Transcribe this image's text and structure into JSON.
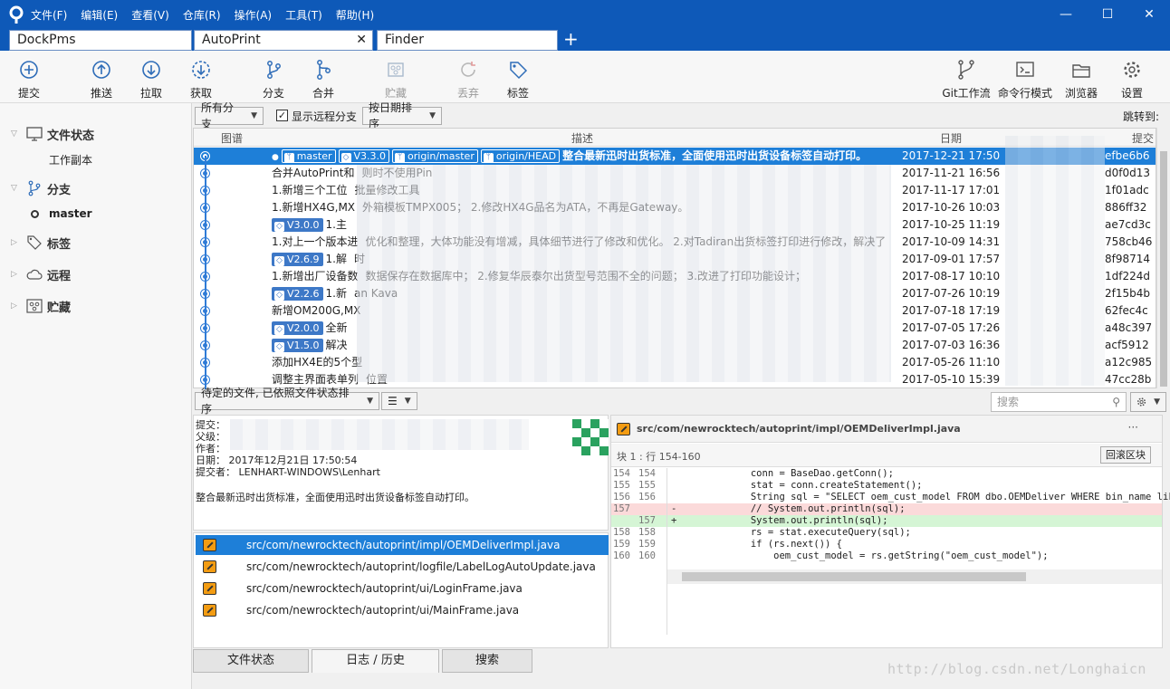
{
  "colors": {
    "titlebar": "#0e59b8",
    "selection": "#1e7fd8",
    "tag": "#3d78c7"
  },
  "menu": [
    "文件(F)",
    "编辑(E)",
    "查看(V)",
    "仓库(R)",
    "操作(A)",
    "工具(T)",
    "帮助(H)"
  ],
  "tabs": {
    "tab1": "DockPms",
    "tab2": "AutoPrint",
    "tab2_close": "✕",
    "tab3": "Finder",
    "add": "+"
  },
  "window_controls": {
    "min": "—",
    "max": "☐",
    "close": "✕"
  },
  "toolbar": {
    "commit": "提交",
    "push": "推送",
    "pull": "拉取",
    "fetch": "获取",
    "branch": "分支",
    "merge": "合并",
    "stash": "贮藏",
    "discard": "丢弃",
    "tag": "标签",
    "git_flow": "Git工作流",
    "terminal": "命令行模式",
    "explorer": "浏览器",
    "settings": "设置"
  },
  "sidebar": {
    "file_status": "文件状态",
    "working_copy": "工作副本",
    "branches": "分支",
    "master": "master",
    "tags": "标签",
    "remotes": "远程",
    "stashes": "贮藏"
  },
  "filters": {
    "all_branches": "所有分支",
    "show_remote": "显示远程分支",
    "sort": "按日期排序",
    "jump_to": "跳转到:"
  },
  "table_headers": {
    "graph": "图谱",
    "desc": "描述",
    "date": "日期",
    "commit": "提交"
  },
  "commits": [
    {
      "refs": [
        "master",
        "V3.3.0",
        "origin/master",
        "origin/HEAD"
      ],
      "ref_types": [
        "branch",
        "tag",
        "branch",
        "branch"
      ],
      "desc": "整合最新迅时出货标准，全面使用迅时出货设备标签自动打印。",
      "date": "2017-12-21 17:50",
      "hash": "efbe6b6"
    },
    {
      "refs": [],
      "desc": "合并AutoPrint和",
      "desc_tail": "则时不使用Pin",
      "date": "2017-11-21 16:56",
      "hash": "d0f0d13"
    },
    {
      "refs": [],
      "desc": "1.新增三个工位",
      "desc_tail": "批量修改工具",
      "date": "2017-11-17 17:01",
      "hash": "1f01adc"
    },
    {
      "refs": [],
      "desc": "1.新增HX4G,MX",
      "desc_tail": "外箱模板TMPX005； 2.修改HX4G品名为ATA，不再是Gateway。",
      "date": "2017-10-26 10:03",
      "hash": "886ff32"
    },
    {
      "refs": [
        "V3.0.0"
      ],
      "ref_types": [
        "tag"
      ],
      "desc": "1.主",
      "desc_tail": "",
      "date": "2017-10-25 11:19",
      "hash": "ae7cd3c"
    },
    {
      "refs": [],
      "desc": "1.对上一个版本进",
      "desc_tail": "优化和整理，大体功能没有增减，具体细节进行了修改和优化。 2.对Tadiran出货标签打印进行修改，解决了",
      "date": "2017-10-09 14:31",
      "hash": "758cb46"
    },
    {
      "refs": [
        "V2.6.9"
      ],
      "ref_types": [
        "tag"
      ],
      "desc": "1.解",
      "desc_tail": "时",
      "date": "2017-09-01 17:57",
      "hash": "8f98714"
    },
    {
      "refs": [],
      "desc": "1.新增出厂设备数",
      "desc_tail": "数据保存在数据库中； 2.修复华辰泰尔出货型号范围不全的问题； 3.改进了打印功能设计；",
      "date": "2017-08-17 10:10",
      "hash": "1df224d"
    },
    {
      "refs": [
        "V2.2.6"
      ],
      "ref_types": [
        "tag"
      ],
      "desc": "1.新",
      "desc_tail": "an Kava",
      "date": "2017-07-26 10:19",
      "hash": "2f15b4b"
    },
    {
      "refs": [],
      "desc": "新增OM200G,MX",
      "desc_tail": "",
      "date": "2017-07-18 17:19",
      "hash": "62fec4c"
    },
    {
      "refs": [
        "V2.0.0"
      ],
      "ref_types": [
        "tag"
      ],
      "desc": "全新",
      "desc_tail": "",
      "date": "2017-07-05 17:26",
      "hash": "a48c397"
    },
    {
      "refs": [
        "V1.5.0"
      ],
      "ref_types": [
        "tag"
      ],
      "desc": "解决",
      "desc_tail": "",
      "date": "2017-07-03 16:36",
      "hash": "acf5912"
    },
    {
      "refs": [],
      "desc": "添加HX4E的5个型",
      "desc_tail": "",
      "date": "2017-05-26 11:10",
      "hash": "a12c985"
    },
    {
      "refs": [],
      "desc": "调整主界面表单列",
      "desc_tail": "位置",
      "date": "2017-05-10 15:39",
      "hash": "47cc28b"
    }
  ],
  "pending": {
    "sort": "待定的文件, 已依照文件状态排序",
    "view": "☰",
    "search_placeholder": "搜索"
  },
  "details": {
    "commit_label": "提交：",
    "parent_label": "父级：",
    "author_label": "作者：",
    "date_label": "日期：",
    "date_value": "2017年12月21日 17:50:54",
    "committer_label": "提交者：",
    "committer_value": "LENHART-WINDOWS\\Lenhart",
    "message": "整合最新迅时出货标准，全面使用迅时出货设备标签自动打印。"
  },
  "files": [
    "src/com/newrocktech/autoprint/impl/OEMDeliverImpl.java",
    "src/com/newrocktech/autoprint/logfile/LabelLogAutoUpdate.java",
    "src/com/newrocktech/autoprint/ui/LoginFrame.java",
    "src/com/newrocktech/autoprint/ui/MainFrame.java"
  ],
  "bottom_tabs": {
    "file_status": "文件状态",
    "log": "日志 / 历史",
    "search": "搜索"
  },
  "diff": {
    "file": "src/com/newrocktech/autoprint/impl/OEMDeliverImpl.java",
    "more": "···",
    "hunk": "块 1 :  行 154-160",
    "revert": "回滚区块",
    "lines": [
      {
        "o": "154",
        "n": "154",
        "t": "",
        "c": "            conn = BaseDao.getConn();"
      },
      {
        "o": "155",
        "n": "155",
        "t": "",
        "c": "            stat = conn.createStatement();"
      },
      {
        "o": "156",
        "n": "156",
        "t": "",
        "c": "            String sql = \"SELECT oem_cust_model FROM dbo.OEMDeliver WHERE bin_name lik"
      },
      {
        "o": "157",
        "n": "",
        "t": "-",
        "c": "            // System.out.println(sql);"
      },
      {
        "o": "",
        "n": "157",
        "t": "+",
        "c": "            System.out.println(sql);"
      },
      {
        "o": "158",
        "n": "158",
        "t": "",
        "c": "            rs = stat.executeQuery(sql);"
      },
      {
        "o": "159",
        "n": "159",
        "t": "",
        "c": "            if (rs.next()) {"
      },
      {
        "o": "160",
        "n": "160",
        "t": "",
        "c": "                oem_cust_model = rs.getString(\"oem_cust_model\");"
      }
    ]
  },
  "watermark": "http://blog.csdn.net/Longhaicn"
}
